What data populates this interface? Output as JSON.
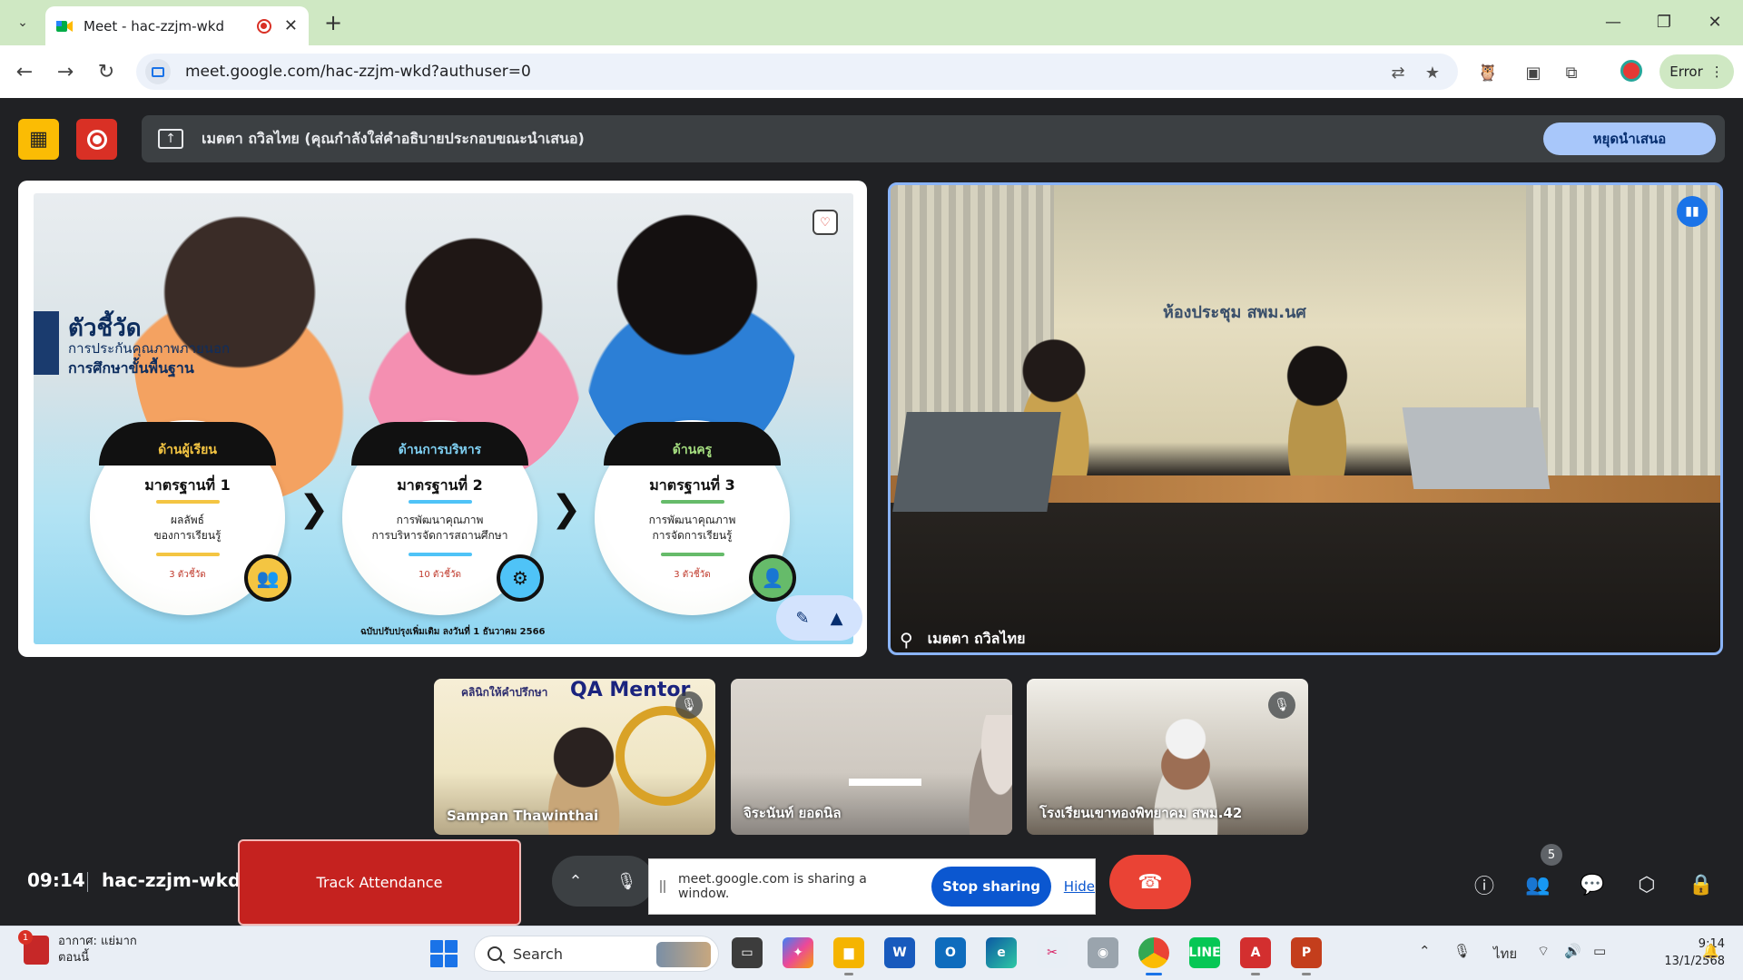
{
  "browser": {
    "tab_title": "Meet - hac-zzjm-wkd",
    "url": "meet.google.com/hac-zzjm-wkd?authuser=0",
    "profile_label": "Error",
    "window_controls": [
      "—",
      "❐",
      "✕"
    ]
  },
  "meet": {
    "presenting_text": "เมตตา ถวิลไทย (คุณกำลังใส่คำอธิบายประกอบขณะนำเสนอ)",
    "stop_presenting_label": "หยุดนำเสนอ",
    "slide": {
      "title": "ตัวชี้วัด",
      "subtitle_line1": "การประกันคุณภาพภายนอก",
      "subtitle_line2": "การศึกษาขั้นพื้นฐาน",
      "columns": [
        {
          "header": "ด้านผู้เรียน",
          "standard": "มาตรฐานที่ 1",
          "desc1": "ผลลัพธ์",
          "desc2": "ของการเรียนรู้",
          "count": "3 ตัวชี้วัด",
          "color": "#f4c542"
        },
        {
          "header": "ด้านการบริหาร",
          "standard": "มาตรฐานที่ 2",
          "desc1": "การพัฒนาคุณภาพ",
          "desc2": "การบริหารจัดการสถานศึกษา",
          "count": "10 ตัวชี้วัด",
          "color": "#4fc3f7"
        },
        {
          "header": "ด้านครู",
          "standard": "มาตรฐานที่ 3",
          "desc1": "การพัฒนาคุณภาพ",
          "desc2": "การจัดการเรียนรู้",
          "count": "3 ตัวชี้วัด",
          "color": "#66bb6a"
        }
      ],
      "footnote": "ฉบับปรับปรุงเพิ่มเติม ลงวันที่ 1 ธันวาคม 2566"
    },
    "main_participant": {
      "name": "เมตตา ถวิลไทย",
      "wall_sign": "ห้องประชุม สพม.นศ"
    },
    "participants": [
      {
        "name": "Sampan Thawinthai",
        "brand": "คลินิกให้คำปรึกษา",
        "brand2": "QA Mentor"
      },
      {
        "name": "จิระนันท์ ยอดนิล"
      },
      {
        "name": "โรงเรียนเขาทองพิทยาคม สพม.42"
      }
    ],
    "participant_count": "5"
  },
  "controls": {
    "time": "09:14",
    "meeting_code": "hac-zzjm-wkd",
    "track_attendance_label": "Track Attendance",
    "sharing_text": "meet.google.com is sharing a window.",
    "stop_sharing_label": "Stop sharing",
    "hide_label": "Hide"
  },
  "taskbar": {
    "weather_line1": "อากาศ: แย่มาก",
    "weather_line2": "ตอนนี้",
    "search_label": "Search",
    "lang": "ไทย",
    "clock_time": "9:14",
    "clock_date": "13/1/2568"
  },
  "colors": {
    "meet_bg": "#202124",
    "accent_blue": "#8ab4f8",
    "leave_red": "#ea4335",
    "track_red": "#c5221f",
    "chrome_tabstrip": "#cfe8c3"
  }
}
